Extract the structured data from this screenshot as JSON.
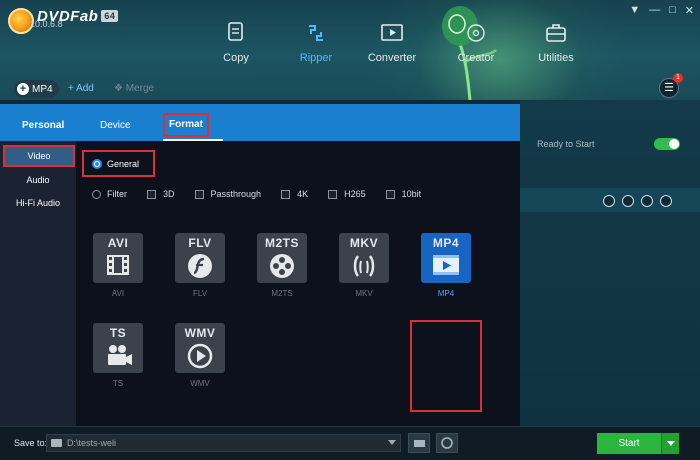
{
  "app": {
    "brand": "DVDFab",
    "version_badge": "64",
    "build": "10.0.6.8"
  },
  "modules": [
    {
      "label": "Copy",
      "icon": "copy-icon"
    },
    {
      "label": "Ripper",
      "icon": "ripper-icon",
      "active": true
    },
    {
      "label": "Converter",
      "icon": "converter-icon"
    },
    {
      "label": "Creator",
      "icon": "creator-icon"
    },
    {
      "label": "Utilities",
      "icon": "toolbox-icon"
    }
  ],
  "toolbar": {
    "profile_label": "MP4",
    "add_label": "Add",
    "merge_label": "Merge",
    "notification_count": "1"
  },
  "task": {
    "status": "Ready to Start"
  },
  "popup": {
    "personal_label": "Personal",
    "tabs": [
      {
        "label": "Device"
      },
      {
        "label": "Format",
        "active": true
      }
    ],
    "categories": [
      {
        "label": "Video",
        "active": true
      },
      {
        "label": "Audio"
      },
      {
        "label": "Hi-Fi Audio"
      }
    ],
    "general_label": "General",
    "filters": [
      {
        "label": "Filter",
        "type": "radio"
      },
      {
        "label": "3D",
        "type": "checkbox"
      },
      {
        "label": "Passthrough",
        "type": "checkbox"
      },
      {
        "label": "4K",
        "type": "checkbox"
      },
      {
        "label": "H265",
        "type": "checkbox"
      },
      {
        "label": "10bit",
        "type": "checkbox"
      }
    ],
    "formats": [
      {
        "title": "AVI",
        "label": "AVI",
        "icon": "film-icon"
      },
      {
        "title": "FLV",
        "label": "FLV",
        "icon": "flash-icon"
      },
      {
        "title": "M2TS",
        "label": "M2TS",
        "icon": "reel-icon"
      },
      {
        "title": "MKV",
        "label": "MKV",
        "icon": "matroska-icon"
      },
      {
        "title": "MP4",
        "label": "MP4",
        "icon": "play-icon",
        "selected": true
      },
      {
        "title": "TS",
        "label": "TS",
        "icon": "camera-icon"
      },
      {
        "title": "WMV",
        "label": "WMV",
        "icon": "play-circle-icon"
      }
    ]
  },
  "bottom": {
    "save_to_label": "Save to:",
    "path": "D:\\tests-weli",
    "start_label": "Start"
  },
  "colors": {
    "accent_blue": "#1b7fd0",
    "highlight_red": "#d9303a",
    "start_green": "#2bb43e"
  }
}
